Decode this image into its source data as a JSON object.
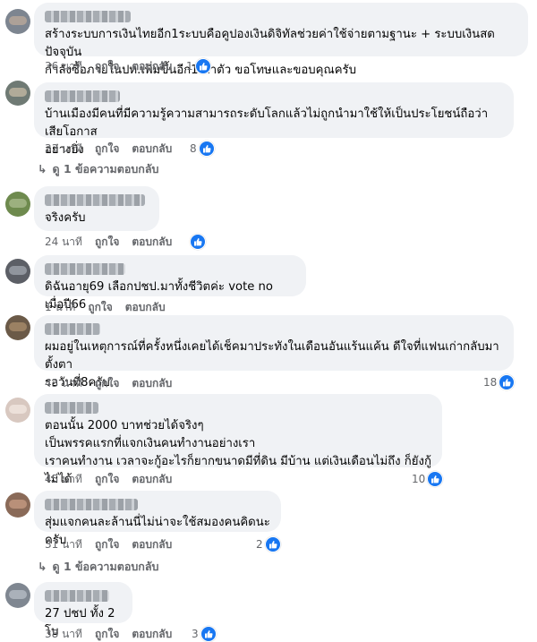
{
  "actions": {
    "like": "ถูกใจ",
    "reply": "ตอบกลับ"
  },
  "view_replies": "ดู 1 ข้อความตอบกลับ",
  "colors": {
    "bubble": "#f0f2f5",
    "like_blue": "#1877f2",
    "meta_gray": "#65676b"
  },
  "comments": [
    {
      "text": "สร้างระบบการเงินไทยอีก1ระบบคือคูปองเงินดิจิทัลช่วยค่าใช้จ่ายตามฐานะ + ระบบเงินสดปัจจุบัน\nกำลังซื้อภายในปท.เพิ่มขึ้นอีก1เท่าตัว ขอโทษและขอบคุณครับ",
      "time": "36 นาที",
      "reactions": "1"
    },
    {
      "text": "บ้านเมืองมีคนที่มีความรู้ความสามารถระดับโลกแล้วไม่ถูกนำมาใช้ให้เป็นประโยชน์ถือว่าเสียโอกาส\nอย่างยิ่ง",
      "time": "33 นาที",
      "reactions": "8"
    },
    {
      "text": "จริงครับ",
      "time": "24 นาที",
      "reactions": ""
    },
    {
      "text": "ดิฉันอายุ69 เลือกปชป.มาทั้งชีวิตค่ะ vote no เมื่อปี66",
      "time": "1 นาที",
      "reactions": ""
    },
    {
      "text": "ผมอยู่ในเหตุการณ์ที่ครั้งหนึ่งเคยได้เช็คมาประทังในเดือนอันแร้นแค้น ดีใจที่แฟนเก่ากลับมา ตั้งตา\nรอวันที่8ครับ",
      "time": "43 นาที",
      "reactions": "18"
    },
    {
      "text": "ตอนนั้น 2000 บาทช่วยได้จริงๆ\nเป็นพรรคแรกที่แจกเงินคนทำงานอย่างเรา\nเราคนทำงาน เวลาจะกู้อะไรก็ยากขนาดมีที่ดิน มีบ้าน แต่เงินเดือนไม่ถึง ก็ยังกู้ไม่ได้",
      "time": "45 นาที",
      "reactions": "10"
    },
    {
      "text": "สุ่มแจกคนละล้านนี่ไม่น่าจะใช้สมองคนคิดนะครับ",
      "time": "31 นาที",
      "reactions": "2"
    },
    {
      "text": "27 ปชป ทั้ง 2 โบ",
      "time": "38 นาที",
      "reactions": "3"
    }
  ]
}
